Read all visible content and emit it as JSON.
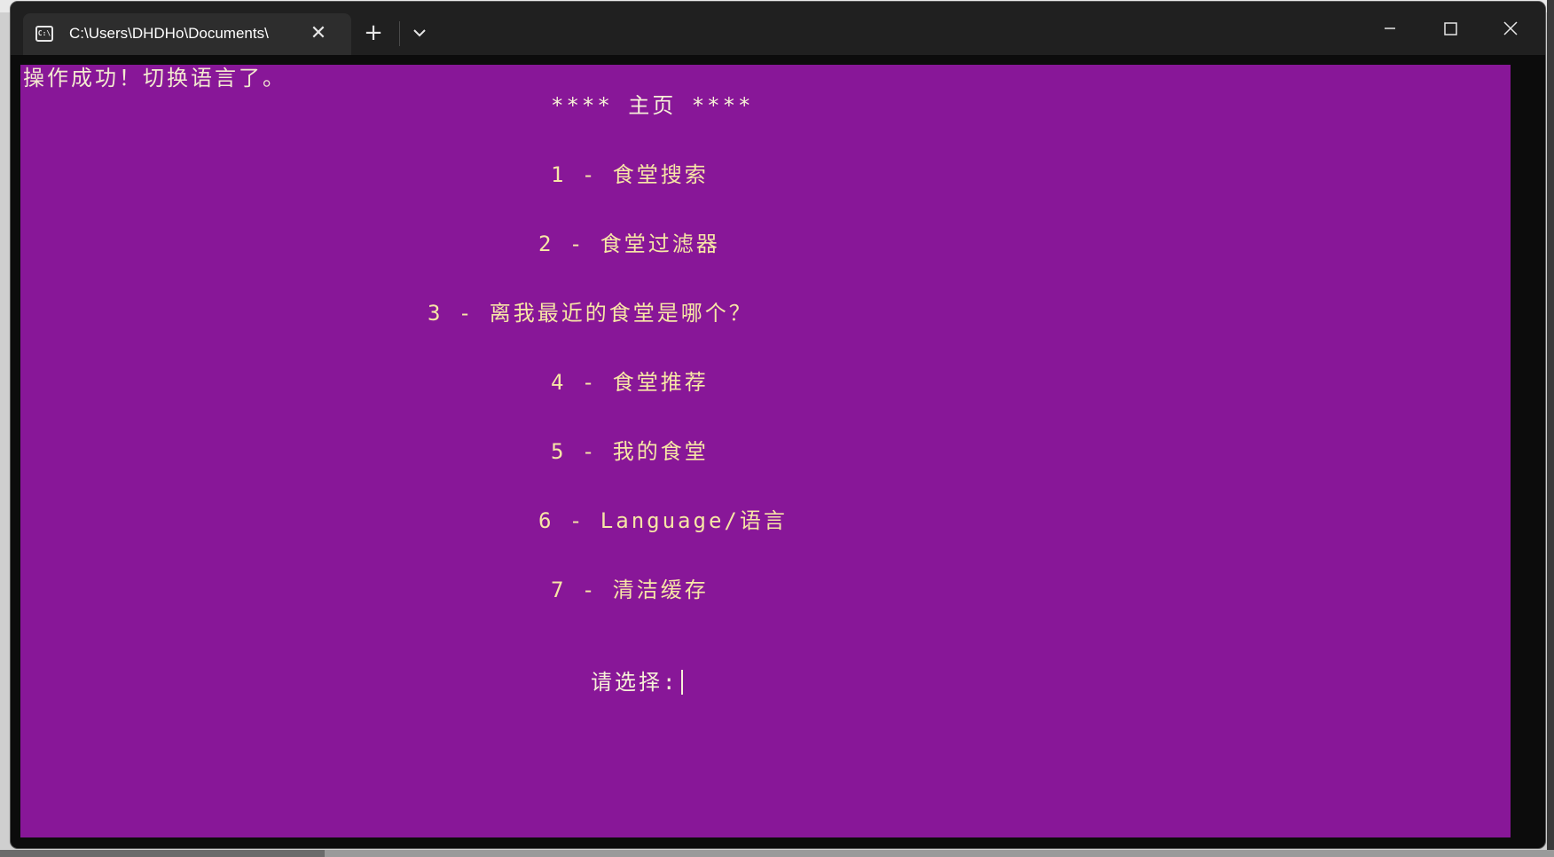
{
  "window": {
    "tab_title": "C:\\Users\\DHDHo\\Documents\\",
    "tab_icon": "terminal-icon",
    "new_tab_icon": "plus-icon",
    "dropdown_icon": "chevron-down-icon",
    "minimize_icon": "minimize-icon",
    "maximize_icon": "maximize-icon",
    "close_icon": "close-icon"
  },
  "terminal": {
    "background": "#881798",
    "text_color": "#f7e6a6",
    "status_message": "操作成功！切换语言了。",
    "heading": "**** 主页 ****",
    "menu_items": [
      "1 - 食堂搜索",
      "2 - 食堂过滤器",
      "3 - 离我最近的食堂是哪个？",
      "4 - 食堂推荐",
      "5 - 我的食堂",
      "6 - Language/语言",
      "7 - 清洁缓存"
    ],
    "prompt": "请选择:"
  }
}
